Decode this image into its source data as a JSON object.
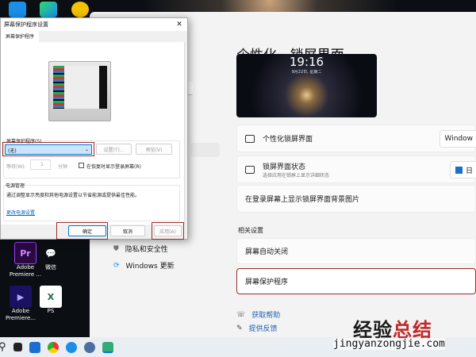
{
  "settings": {
    "breadcrumb_parent": "个性化",
    "breadcrumb_sep": "›",
    "breadcrumb_current": "锁屏界面",
    "lock_preview": {
      "time": "19:16",
      "date": "9月22日, 星期二"
    },
    "cards": [
      {
        "label": "个性化锁屏界面",
        "control": "Window"
      },
      {
        "label": "锁屏界面状态",
        "sub": "选择应用在锁屏上显示详细状态",
        "control": "日"
      },
      {
        "label": "在登录屏幕上显示锁屏界面背景图片"
      }
    ],
    "related_heading": "相关设置",
    "related": [
      {
        "label": "屏幕自动关闭"
      },
      {
        "label": "屏幕保护程序"
      }
    ],
    "help": "获取帮助",
    "feedback": "提供反馈",
    "sidebar": [
      {
        "label": "隐私和安全性"
      },
      {
        "label": "Windows 更新"
      }
    ],
    "search_icon": "⌕"
  },
  "dialog": {
    "title": "屏幕保护程序设置",
    "close": "✕",
    "tab": "屏幕保护程序",
    "group_label": "屏幕保护程序(S)",
    "selected": "(无)",
    "settings_btn": "设置(T)...",
    "preview_btn": "预览(V)",
    "wait_label": "等待(W):",
    "wait_value": "1",
    "minutes": "分钟",
    "resume_checkbox": "在恢复时显示登录屏幕(R)",
    "resume_checked": false,
    "power_heading": "电源管理",
    "power_text": "通过调整显示亮度和其他电源设置以节省能源或提供最佳性能。",
    "power_link": "更改电源设置",
    "ok": "确定",
    "cancel": "取消",
    "apply": "应用(A)"
  },
  "desktop": [
    {
      "label": "Adobe Premiere ...",
      "glyph": "Pr"
    },
    {
      "label": "微信",
      "glyph": "💬"
    },
    {
      "label": "Adobe Premiere...",
      "glyph": "▶"
    },
    {
      "label": "PS",
      "glyph": "X"
    }
  ],
  "watermark": {
    "a": "经验",
    "b": "总结",
    "url": "jingyanzongjie.com"
  }
}
